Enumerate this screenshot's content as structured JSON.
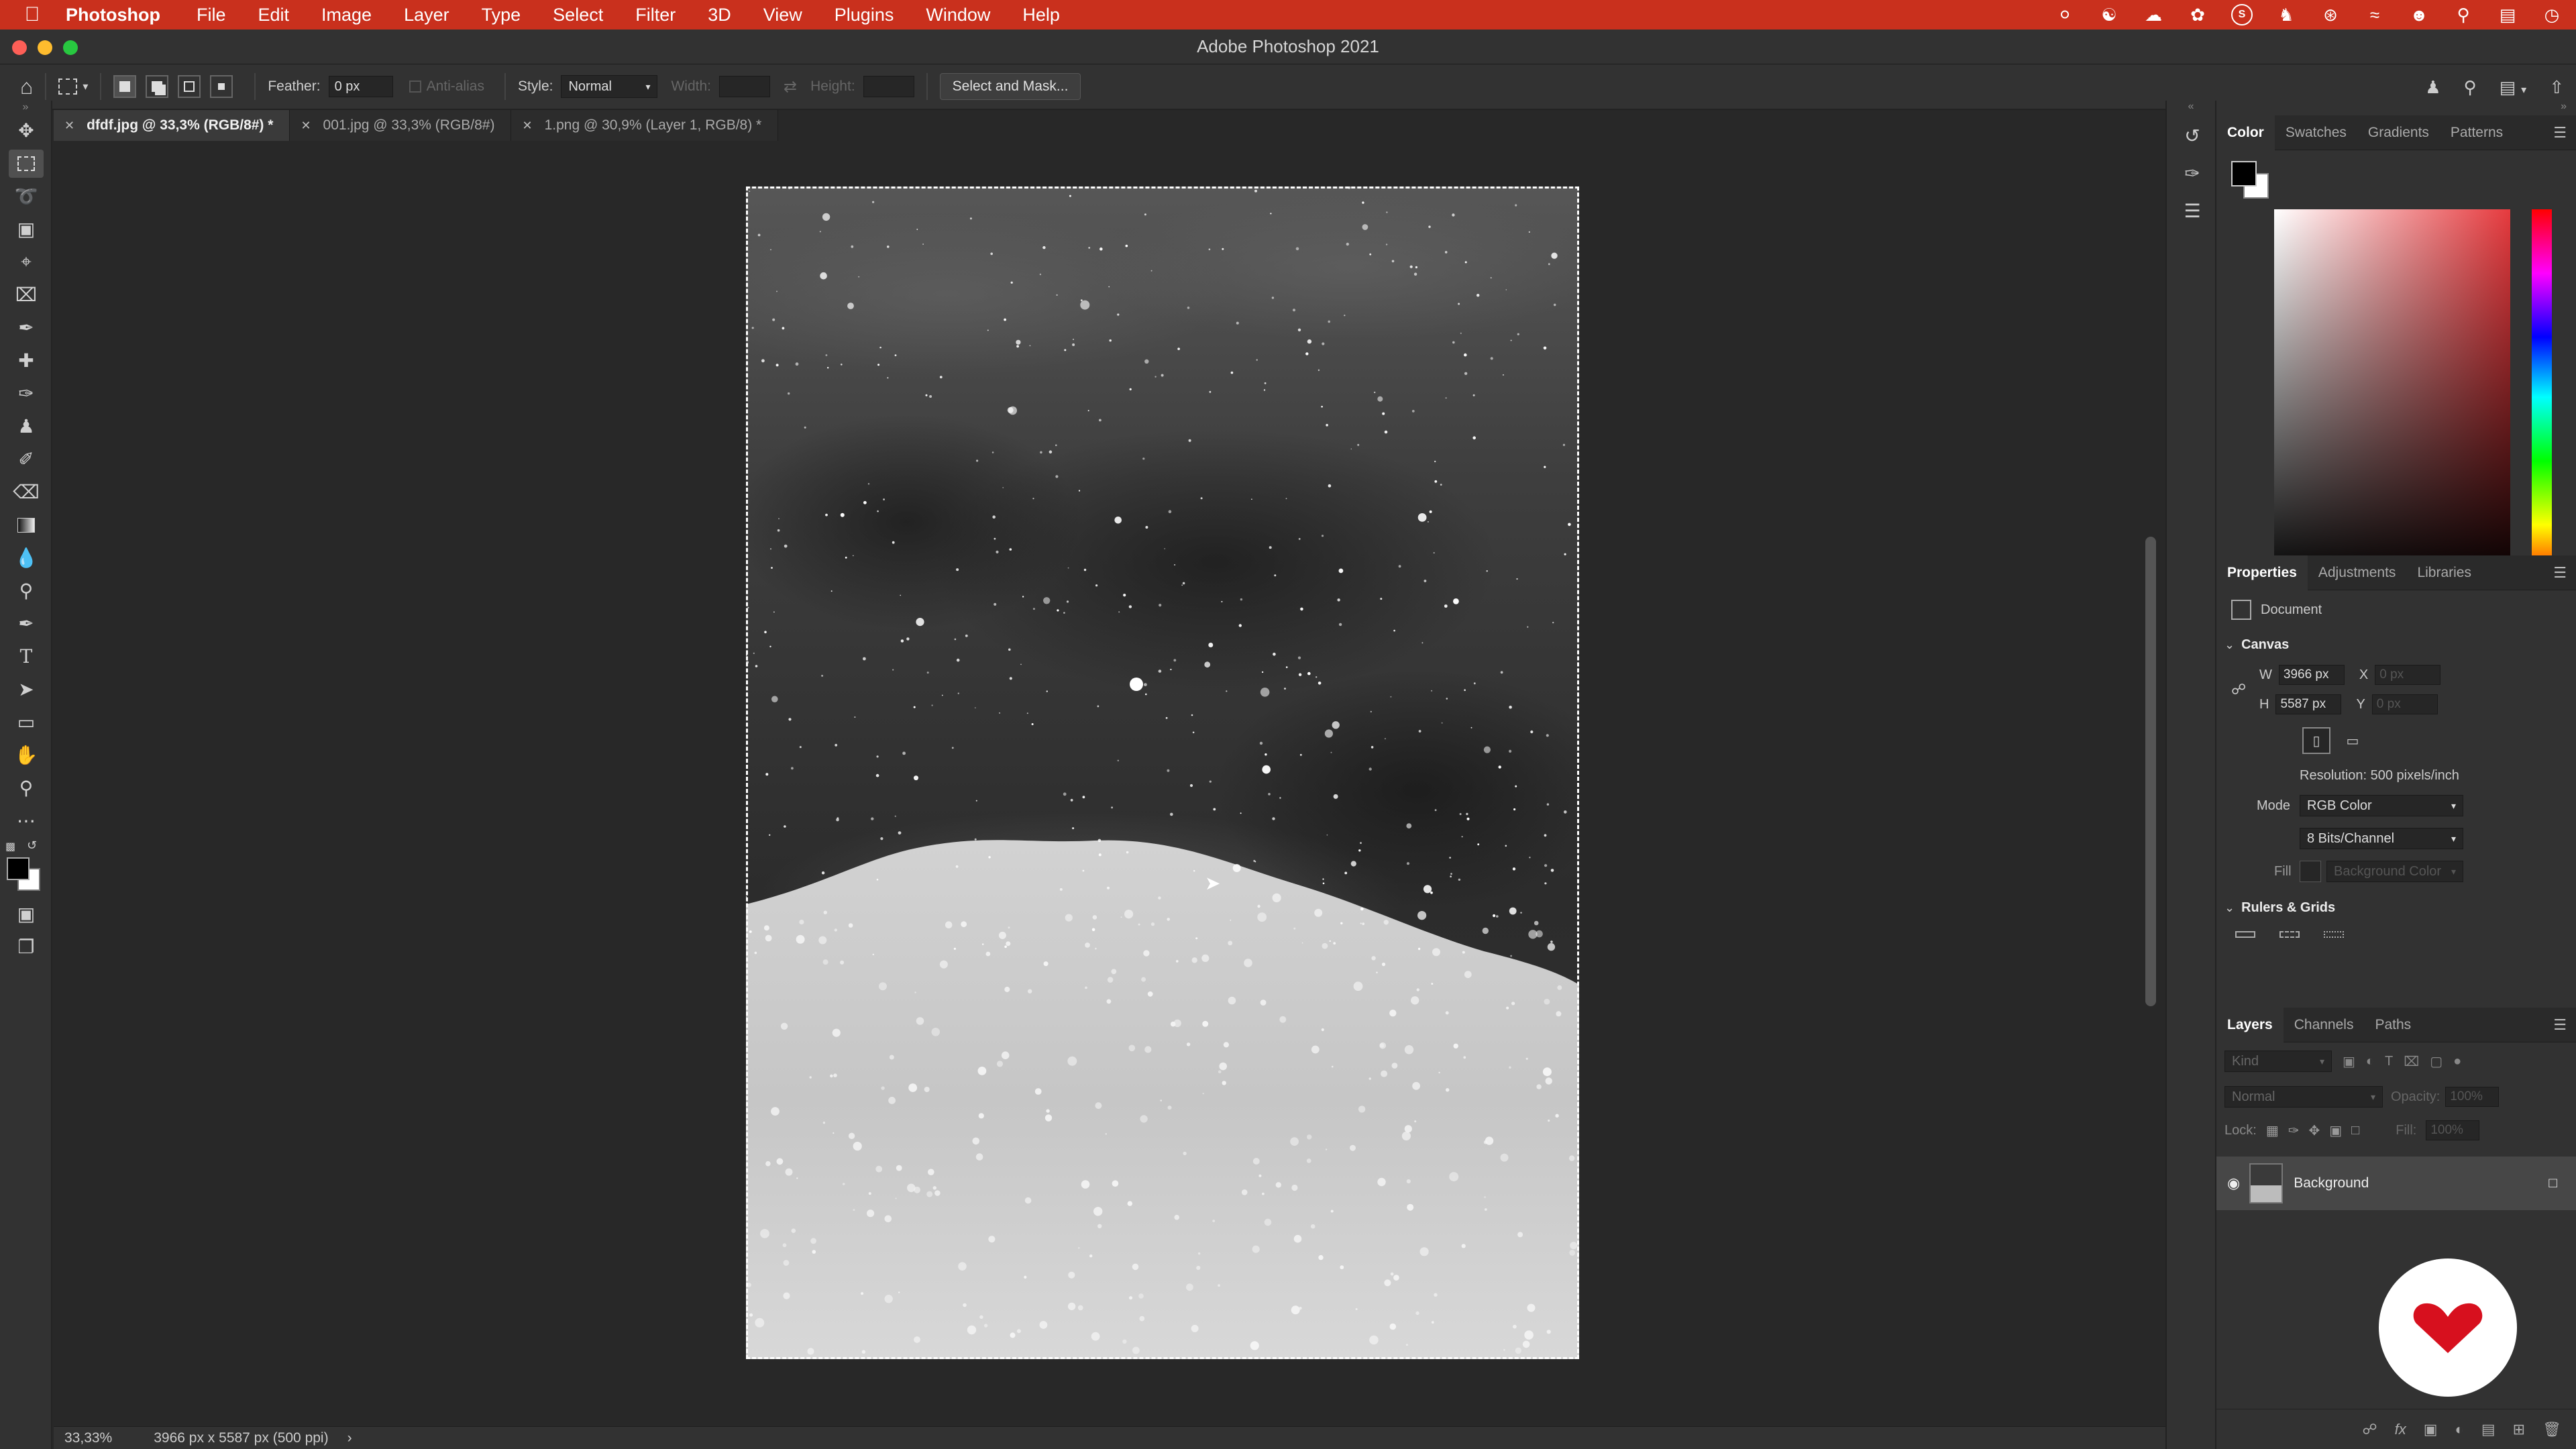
{
  "menubar": {
    "app": "Photoshop",
    "items": [
      "File",
      "Edit",
      "Image",
      "Layer",
      "Type",
      "Select",
      "Filter",
      "3D",
      "View",
      "Plugins",
      "Window",
      "Help"
    ]
  },
  "window": {
    "title": "Adobe Photoshop 2021"
  },
  "options": {
    "feather_label": "Feather:",
    "feather_value": "0 px",
    "antialias_label": "Anti-alias",
    "style_label": "Style:",
    "style_value": "Normal",
    "width_label": "Width:",
    "height_label": "Height:",
    "select_mask": "Select and Mask..."
  },
  "tabs": [
    {
      "label": "dfdf.jpg @ 33,3% (RGB/8#) *"
    },
    {
      "label": "001.jpg @ 33,3% (RGB/8#)"
    },
    {
      "label": "1.png @ 30,9% (Layer 1, RGB/8) *"
    }
  ],
  "status": {
    "zoom": "33,33%",
    "info": "3966 px x 5587 px (500 ppi)"
  },
  "color_panel": {
    "tabs": [
      "Color",
      "Swatches",
      "Gradients",
      "Patterns"
    ],
    "accent": "#e63a3e"
  },
  "properties": {
    "tabs": [
      "Properties",
      "Adjustments",
      "Libraries"
    ],
    "document_label": "Document",
    "canvas_label": "Canvas",
    "w_label": "W",
    "w_value": "3966 px",
    "h_label": "H",
    "h_value": "5587 px",
    "x_label": "X",
    "x_value": "0 px",
    "y_label": "Y",
    "y_value": "0 px",
    "resolution": "Resolution: 500 pixels/inch",
    "mode_label": "Mode",
    "mode_value": "RGB Color",
    "bits_value": "8 Bits/Channel",
    "fill_label": "Fill",
    "fill_value": "Background Color",
    "rulers_label": "Rulers & Grids"
  },
  "layers_panel": {
    "tabs": [
      "Layers",
      "Channels",
      "Paths"
    ],
    "kind_placeholder": "Kind",
    "blend": "Normal",
    "opacity_label": "Opacity:",
    "opacity_value": "100%",
    "lock_label": "Lock:",
    "fill_label": "Fill:",
    "fill_value": "100%",
    "layer_name": "Background"
  }
}
